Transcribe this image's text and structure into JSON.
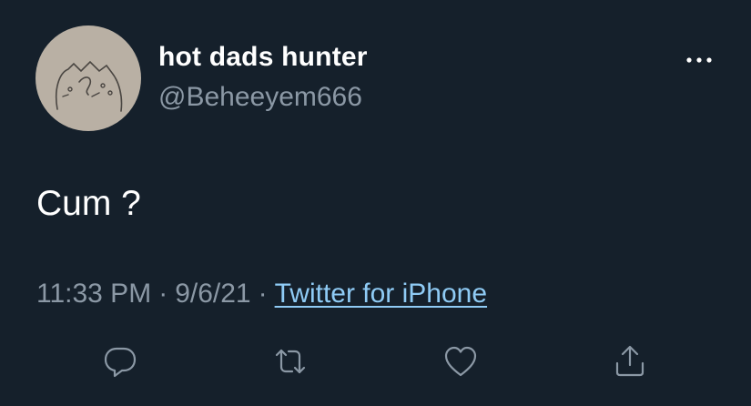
{
  "user": {
    "display_name": "hot dads hunter",
    "handle": "@Beheeyem666"
  },
  "tweet": {
    "text": "Cum ?"
  },
  "meta": {
    "time": "11:33 PM",
    "separator": "·",
    "date": "9/6/21",
    "source": "Twitter for iPhone"
  },
  "actions": {
    "icons": [
      "reply-icon",
      "retweet-icon",
      "like-icon",
      "share-icon"
    ]
  },
  "colors": {
    "background": "#15202b",
    "primary_text": "#ffffff",
    "secondary_text": "#8b98a5",
    "link": "#8fcbf5",
    "avatar_bg": "#b9b0a4"
  }
}
